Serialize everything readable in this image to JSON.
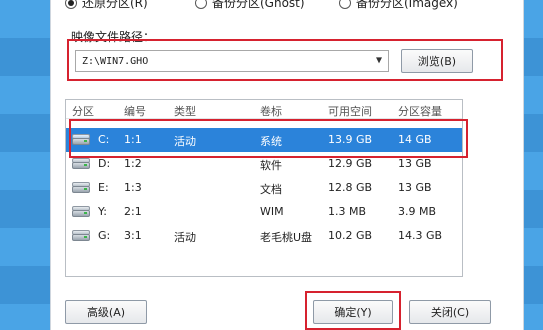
{
  "mode_options": [
    {
      "label": "还原分区(R)",
      "selected": true
    },
    {
      "label": "备份分区(Ghost)",
      "selected": false
    },
    {
      "label": "备份分区(Imagex)",
      "selected": false
    }
  ],
  "image_path": {
    "label": "映像文件路径：",
    "value": "Z:\\WIN7.GHO",
    "browse_label": "浏览(B)"
  },
  "partition_table": {
    "columns": [
      "分区",
      "编号",
      "类型",
      "卷标",
      "可用空间",
      "分区容量"
    ],
    "rows": [
      {
        "drive": "C:",
        "number": "1:1",
        "type": "活动",
        "label": "系统",
        "free": "13.9 GB",
        "capacity": "14 GB",
        "selected": true
      },
      {
        "drive": "D:",
        "number": "1:2",
        "type": "",
        "label": "软件",
        "free": "12.9 GB",
        "capacity": "13 GB",
        "selected": false
      },
      {
        "drive": "E:",
        "number": "1:3",
        "type": "",
        "label": "文档",
        "free": "12.8 GB",
        "capacity": "13 GB",
        "selected": false
      },
      {
        "drive": "Y:",
        "number": "2:1",
        "type": "",
        "label": "WIM",
        "free": "1.3 MB",
        "capacity": "3.9 MB",
        "selected": false
      },
      {
        "drive": "G:",
        "number": "3:1",
        "type": "活动",
        "label": "老毛桃U盘",
        "free": "10.2 GB",
        "capacity": "14.3 GB",
        "selected": false
      }
    ]
  },
  "buttons": {
    "advanced": "高级(A)",
    "ok": "确定(Y)",
    "close": "关闭(C)"
  },
  "colors": {
    "highlight_border": "#d6222f",
    "selected_row": "#2b83da",
    "desktop_blue": "#4aa4e6"
  }
}
